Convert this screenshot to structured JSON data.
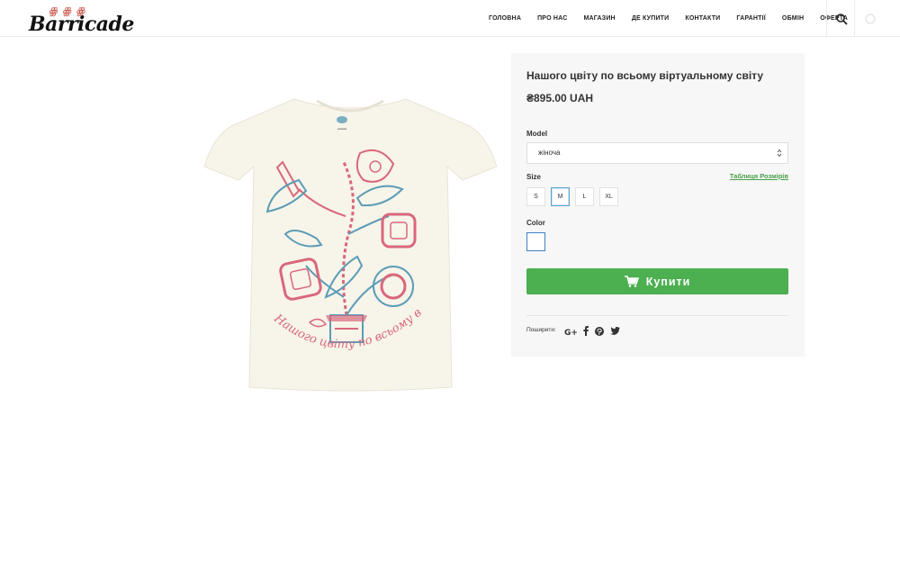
{
  "brand": {
    "logo_text": "Barricade"
  },
  "nav": {
    "items": [
      {
        "label": "Головна"
      },
      {
        "label": "Про нас"
      },
      {
        "label": "Магазин"
      },
      {
        "label": "Де купити"
      },
      {
        "label": "Контакти"
      },
      {
        "label": "Гарантії"
      },
      {
        "label": "Обмін"
      },
      {
        "label": "Оферта"
      }
    ],
    "search_icon": "search-icon",
    "cart_icon": "cart-icon"
  },
  "product": {
    "title": "Нашого цвіту по всьому віртуальному світу",
    "price": "₴895.00 UAH",
    "model_label": "Model",
    "model_value": "жіноча",
    "size_label": "Size",
    "size_chart_link": "Таблиця Розмірів",
    "sizes": [
      "S",
      "M",
      "L",
      "XL"
    ],
    "selected_size": "M",
    "color_label": "Color",
    "color_swatch": "#ffffff",
    "buy_label": "Купити",
    "share_label": "Поширити:",
    "share_icons": [
      "google-plus-icon",
      "facebook-icon",
      "pinterest-icon",
      "twitter-icon"
    ],
    "shirt_print_text": "Нашого цвіту по всьому віртуальному світу"
  },
  "colors": {
    "accent": "#4caf50",
    "panel_bg": "#f7f7f7",
    "shirt": "#f7f4ea",
    "print_pink": "#d9677c",
    "print_blue": "#5c9cb6"
  }
}
